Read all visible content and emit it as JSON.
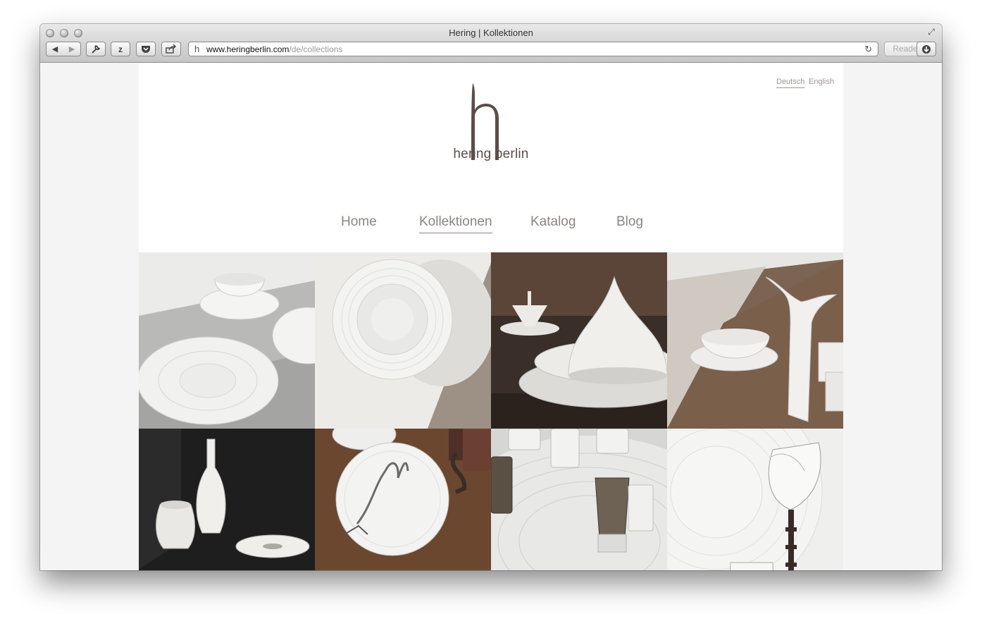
{
  "browser": {
    "window_title": "Hering | Kollektionen",
    "url_host": "www.heringberlin.com",
    "url_path": "/de/collections",
    "reader_label": "Reader"
  },
  "site": {
    "brand": "hering berlin",
    "languages": {
      "active": "Deutsch",
      "other": "English"
    },
    "nav": [
      {
        "label": "Home"
      },
      {
        "label": "Kollektionen",
        "active": true
      },
      {
        "label": "Katalog"
      },
      {
        "label": "Blog"
      }
    ],
    "colors": {
      "brand": "#5a4e47",
      "nav_text": "#8b8583"
    }
  },
  "gallery": {
    "tiles": [
      {
        "subject": "white bowls and plates on steel counter"
      },
      {
        "subject": "ribbed white deep plate on beige"
      },
      {
        "subject": "lidded tureen and plates on dark wood"
      },
      {
        "subject": "pitcher, bowl and cups on wooden table"
      },
      {
        "subject": "white vases on black background"
      },
      {
        "subject": "plate with drawing on walnut table"
      },
      {
        "subject": "glasses on ribbed white platter"
      },
      {
        "subject": "ribbed plate with stemmed glasses"
      }
    ]
  }
}
